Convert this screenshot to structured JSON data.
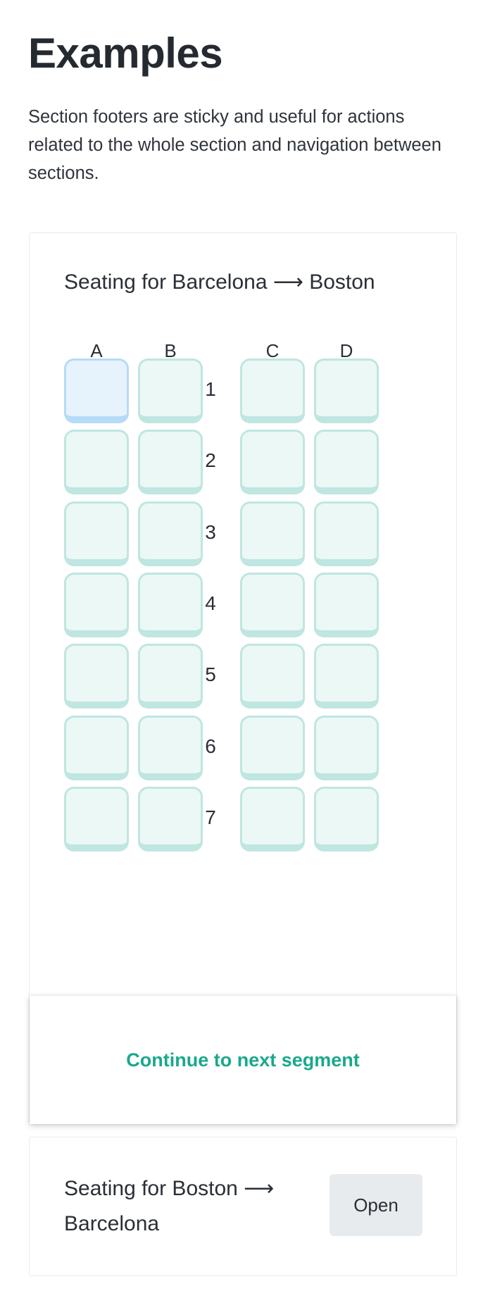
{
  "page": {
    "title": "Examples",
    "description": "Section footers are sticky and useful for actions related to the whole section and navigation between sections."
  },
  "section1": {
    "title_from": "Seating for Barcelona",
    "arrow": "⟶",
    "title_to": "Boston",
    "columns": [
      "A",
      "B",
      "C",
      "D"
    ],
    "rows": [
      "1",
      "2",
      "3",
      "4",
      "5",
      "6",
      "7"
    ],
    "selected_seat": "1A",
    "footer_action": "Continue to next segment"
  },
  "section2": {
    "title_from": "Seating for Boston",
    "arrow": "⟶",
    "title_to": "Barcelona",
    "open_label": "Open"
  },
  "colors": {
    "seat_border": "#bfe6e1",
    "seat_fill": "#ecf8f6",
    "seat_selected_border": "#b5dbf6",
    "seat_selected_fill": "#e6f3fc",
    "accent": "#1aa88c"
  }
}
